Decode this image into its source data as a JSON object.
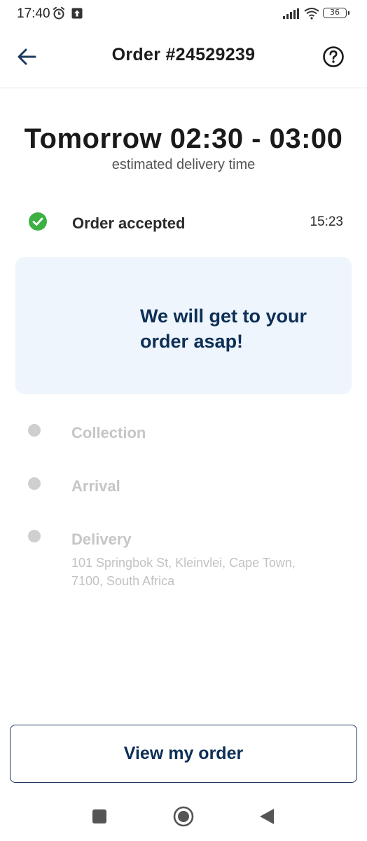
{
  "status_bar": {
    "time": "17:40",
    "battery": "36",
    "icons": [
      "alarm-icon",
      "upload-icon",
      "signal-icon",
      "wifi-icon",
      "battery-icon"
    ]
  },
  "header": {
    "title": "Order #24529239",
    "back_icon": "arrow-left-icon",
    "help_icon": "help-circle-icon"
  },
  "eta": {
    "time_range": "Tomorrow 02:30 - 03:00",
    "subtitle": "estimated delivery time"
  },
  "timeline": {
    "accepted": {
      "label": "Order accepted",
      "time": "15:23",
      "status": "done"
    },
    "info_message": "We will get to your order asap!",
    "collection": {
      "label": "Collection",
      "status": "pending"
    },
    "arrival": {
      "label": "Arrival",
      "status": "pending"
    },
    "delivery": {
      "label": "Delivery",
      "status": "pending",
      "address": "101 Springbok St, Kleinvlei, Cape Town, 7100, South Africa"
    }
  },
  "actions": {
    "view_order_label": "View my order"
  },
  "nav_bar": {
    "icons": [
      "recents-square-icon",
      "home-circle-icon",
      "back-triangle-icon"
    ]
  },
  "colors": {
    "brand_navy": "#0d2f55",
    "success_green": "#3cb043",
    "card_bg": "#eef5fd",
    "pending_gray": "#c6c6c6"
  }
}
